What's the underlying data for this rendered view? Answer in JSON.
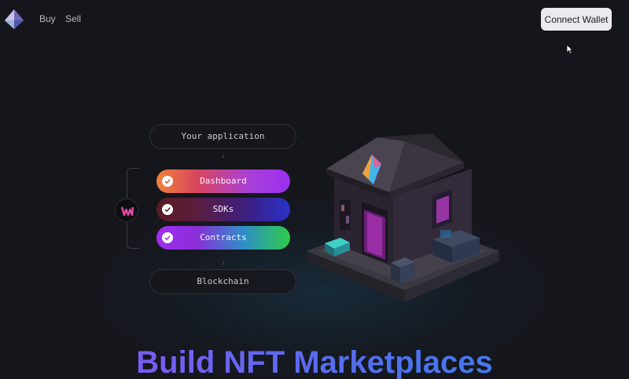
{
  "nav": {
    "logo_icon": "prism-logo-icon",
    "links": [
      {
        "label": "Buy"
      },
      {
        "label": "Sell"
      }
    ],
    "connect_wallet_label": "Connect Wallet"
  },
  "diagram": {
    "top_label": "Your application",
    "features": [
      {
        "label": "Dashboard",
        "icon": "check-icon"
      },
      {
        "label": "SDKs",
        "icon": "check-icon"
      },
      {
        "label": "Contracts",
        "icon": "check-icon"
      }
    ],
    "bottom_label": "Blockchain",
    "badge_icon": "brand-logo-icon"
  },
  "hero": {
    "headline": "Build NFT Marketplaces",
    "illustration": "isometric-store-illustration"
  },
  "colors": {
    "background": "#15161b",
    "button_bg": "#eceaee",
    "headline_start": "#7b5cf0",
    "headline_end": "#3f7fea"
  }
}
